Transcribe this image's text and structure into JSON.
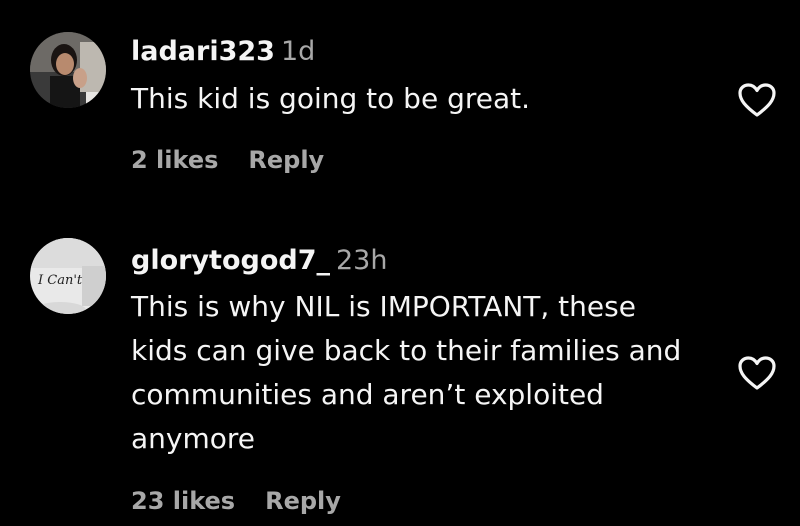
{
  "comments": [
    {
      "username": "ladari323",
      "time": "1d",
      "text_lines": [
        "This kid is going to be great."
      ],
      "likes": "2 likes",
      "reply_label": "Reply",
      "avatar_icon": "profile-photo-icon",
      "like_icon": "heart-outline-icon"
    },
    {
      "username": "glorytogod7_",
      "time": "23h",
      "text_lines": [
        "This is why NIL is IMPORTANT, these",
        "kids can give back to their families and",
        "communities and aren’t exploited",
        "anymore"
      ],
      "likes": "23 likes",
      "reply_label": "Reply",
      "avatar_text": "I Can't",
      "avatar_icon": "profile-photo-icon",
      "like_icon": "heart-outline-icon"
    }
  ],
  "colors": {
    "background": "#000000",
    "primary_text": "#f5f5f5",
    "secondary_text": "#a8a8a8"
  }
}
